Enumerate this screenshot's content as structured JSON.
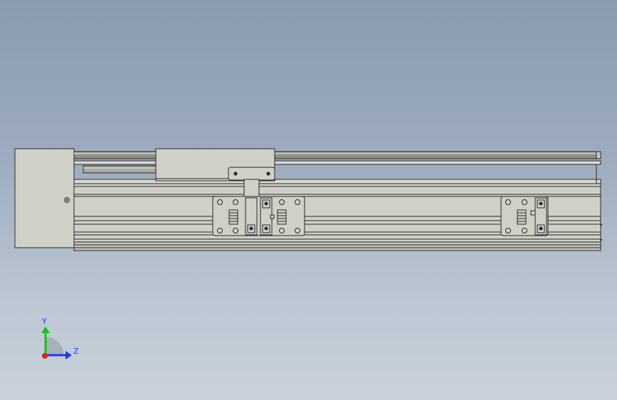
{
  "triad": {
    "y_label": "Y",
    "z_label": "Z",
    "colors": {
      "y": "#13c313",
      "z": "#1b3cff",
      "x": "#e0201a",
      "quadrant": "#a8b0ba"
    }
  },
  "model": {
    "colors": {
      "body": "#cfd0c6",
      "body_dark": "#a9aaa1",
      "edge": "#2a2a2a",
      "rail_dark": "#6b6c66"
    }
  }
}
